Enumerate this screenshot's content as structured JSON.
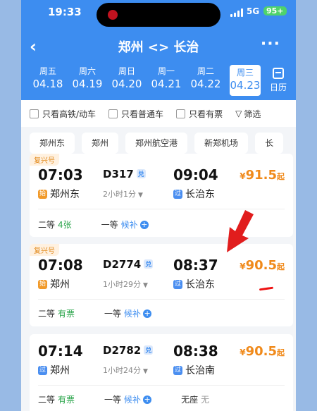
{
  "status": {
    "time": "19:33",
    "network": "5G",
    "battery": "95+"
  },
  "nav": {
    "back_icon": "chevron-left-icon",
    "title": "郑州 <> 长治",
    "more_icon": "more-icon"
  },
  "dates": [
    {
      "weekday": "周五",
      "date": "04.18"
    },
    {
      "weekday": "周六",
      "date": "04.19"
    },
    {
      "weekday": "周日",
      "date": "04.20"
    },
    {
      "weekday": "周一",
      "date": "04.21"
    },
    {
      "weekday": "周二",
      "date": "04.22"
    },
    {
      "weekday": "周三",
      "date": "04.23",
      "selected": true
    }
  ],
  "calendar_label": "日历",
  "filters": {
    "high_speed": "只看高铁/动车",
    "normal": "只看普通车",
    "available": "只看有票",
    "filter": "筛选"
  },
  "stations": [
    "郑州东",
    "郑州",
    "郑州航空港",
    "新郑机场",
    "长"
  ],
  "trains": [
    {
      "tag": "复兴号",
      "departure": "07:03",
      "arrival": "09:04",
      "code": "D317",
      "code_badge": "兑",
      "duration": "2小时1分",
      "from_badge": "始",
      "from": "郑州东",
      "to_badge": "过",
      "to": "长治东",
      "price_symbol": "¥",
      "price": "91.5",
      "price_suffix": "起",
      "seats": [
        {
          "class": "二等",
          "value": "4张",
          "style": "green"
        },
        {
          "class": "一等",
          "value": "候补",
          "style": "blue",
          "plus": true
        }
      ]
    },
    {
      "tag": "复兴号",
      "departure": "07:08",
      "arrival": "08:37",
      "code": "D2774",
      "code_badge": "兑",
      "duration": "1小时29分",
      "from_badge": "始",
      "from": "郑州",
      "to_badge": "过",
      "to": "长治东",
      "price_symbol": "¥",
      "price": "90.5",
      "price_suffix": "起",
      "seats": [
        {
          "class": "二等",
          "value": "有票",
          "style": "green"
        },
        {
          "class": "一等",
          "value": "候补",
          "style": "blue",
          "plus": true
        }
      ]
    },
    {
      "tag": "",
      "departure": "07:14",
      "arrival": "08:38",
      "code": "D2782",
      "code_badge": "兑",
      "duration": "1小时24分",
      "from_badge": "过",
      "from": "郑州",
      "to_badge": "过",
      "to": "长治南",
      "price_symbol": "¥",
      "price": "90.5",
      "price_suffix": "起",
      "seats": [
        {
          "class": "二等",
          "value": "有票",
          "style": "green"
        },
        {
          "class": "一等",
          "value": "候补",
          "style": "blue",
          "plus": true
        },
        {
          "class": "无座",
          "value": "无",
          "style": "gray"
        }
      ]
    }
  ],
  "annotation_color": "#e11d1d"
}
